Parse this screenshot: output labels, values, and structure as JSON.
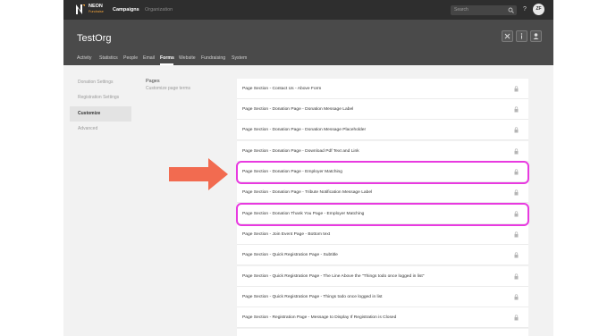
{
  "topbar": {
    "logo_text": "NEON",
    "logo_sub": "Fundraise",
    "nav": [
      {
        "label": "Campaigns",
        "active": true
      },
      {
        "label": "Organization",
        "active": false
      }
    ],
    "search_placeholder": "Search",
    "help_label": "?",
    "avatar_initials": "ZF"
  },
  "header": {
    "title": "TestOrg",
    "buttons": [
      {
        "icon": "tools-icon"
      },
      {
        "icon": "info-icon"
      },
      {
        "icon": "user-icon"
      }
    ]
  },
  "tabs": [
    {
      "label": "Activity",
      "active": false
    },
    {
      "label": "Statistics",
      "active": false
    },
    {
      "label": "People",
      "active": false
    },
    {
      "label": "Email",
      "active": false
    },
    {
      "label": "Forms",
      "active": true
    },
    {
      "label": "Website",
      "active": false
    },
    {
      "label": "Fundraising",
      "active": false
    },
    {
      "label": "System",
      "active": false
    }
  ],
  "leftnav": [
    {
      "label": "Donation Settings",
      "active": false
    },
    {
      "label": "Registration Settings",
      "active": false
    },
    {
      "label": "Customize",
      "active": true
    },
    {
      "label": "Advanced",
      "active": false
    }
  ],
  "pages": {
    "title": "Pages",
    "subtitle": "Customize page terms"
  },
  "rows": [
    {
      "label": "Page Section - Contact Us - Above Form",
      "highlighted": false
    },
    {
      "label": "Page Section - Donation Page - Donation Message Label",
      "highlighted": false
    },
    {
      "label": "Page Section - Donation Page - Donation Message Placeholder",
      "highlighted": false
    },
    {
      "label": "Page Section - Donation Page - Download Pdf Text and Link",
      "highlighted": false
    },
    {
      "label": "Page Section - Donation Page - Employer Matching",
      "highlighted": true
    },
    {
      "label": "Page Section - Donation Page - Tribute Notification Message Label",
      "highlighted": false
    },
    {
      "label": "Page Section - Donation Thank You Page - Employer Matching",
      "highlighted": true
    },
    {
      "label": "Page Section - Join Event Page - Bottom text",
      "highlighted": false
    },
    {
      "label": "Page Section - Quick Registration Page - Subtitle",
      "highlighted": false
    },
    {
      "label": "Page Section - Quick Registration Page - The Line Above the \"Things todo once logged in list\"",
      "highlighted": false
    },
    {
      "label": "Page Section - Quick Registration Page - Things todo once logged in list",
      "highlighted": false
    },
    {
      "label": "Page Section - Registration Page - Message to Display If Registration is Closed",
      "highlighted": false
    }
  ],
  "colors": {
    "highlight": "#e83ae0",
    "arrow": "#f26b50",
    "accent": "#f2a33a"
  }
}
